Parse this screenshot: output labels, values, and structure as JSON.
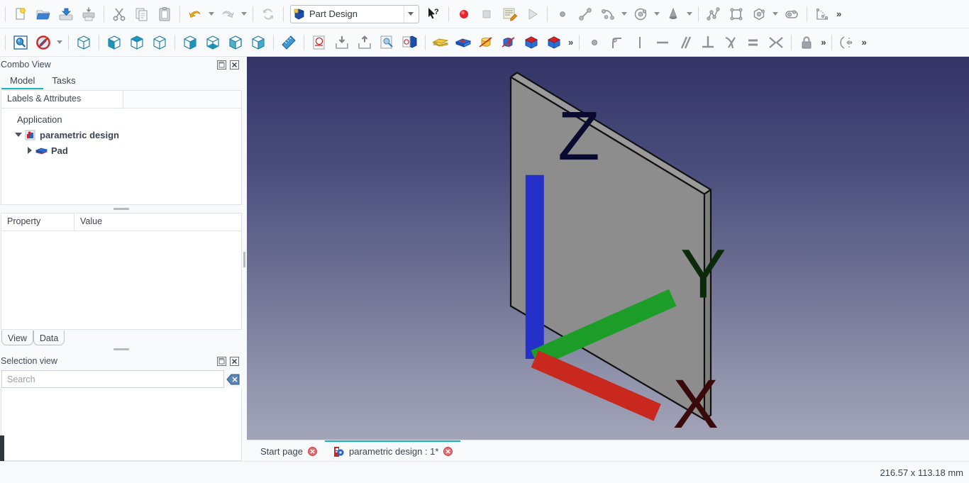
{
  "toolbars": {
    "file": [
      {
        "name": "new-document-button",
        "label": "New"
      },
      {
        "name": "open-document-button",
        "label": "Open"
      },
      {
        "name": "save-document-button",
        "label": "Save"
      },
      {
        "name": "print-document-button",
        "label": "Print"
      },
      {
        "name": "cut-button",
        "label": "Cut"
      },
      {
        "name": "copy-button",
        "label": "Copy"
      },
      {
        "name": "paste-button",
        "label": "Paste"
      },
      {
        "name": "undo-button",
        "label": "Undo"
      },
      {
        "name": "redo-button",
        "label": "Redo"
      },
      {
        "name": "refresh-button",
        "label": "Refresh"
      }
    ],
    "workbench": {
      "selected": "Part Design",
      "icon": "part-design-icon"
    },
    "whats_this": {
      "name": "whats-this-button",
      "label": "What's This?"
    },
    "macro": [
      {
        "name": "macro-record-button",
        "label": "Macro recording"
      },
      {
        "name": "macro-stop-button",
        "label": "Stop macro recording"
      },
      {
        "name": "macro-edit-button",
        "label": "Macros"
      },
      {
        "name": "macro-execute-button",
        "label": "Execute macro"
      }
    ],
    "sketcher_geometry": [
      {
        "name": "create-point-icon",
        "label": "Create point"
      },
      {
        "name": "create-line-icon",
        "label": "Create line"
      },
      {
        "name": "create-arc-icon",
        "label": "Create arc"
      },
      {
        "name": "create-circle-icon",
        "label": "Create circle"
      },
      {
        "name": "create-conic-icon",
        "label": "Create conic"
      },
      {
        "name": "create-polyline-icon",
        "label": "Create polyline"
      },
      {
        "name": "create-rectangle-icon",
        "label": "Create rectangle"
      },
      {
        "name": "create-polygon-icon",
        "label": "Create polygon"
      },
      {
        "name": "create-slot-icon",
        "label": "Create slot"
      },
      {
        "name": "create-bspline-icon",
        "label": "Create B-spline"
      }
    ],
    "view": [
      {
        "name": "fit-all-icon",
        "label": "Fit all"
      },
      {
        "name": "draw-style-icon",
        "label": "Draw style"
      },
      {
        "name": "axonometric-view-icon",
        "label": "Axonometric"
      },
      {
        "name": "front-view-icon",
        "label": "Front"
      },
      {
        "name": "top-view-icon",
        "label": "Top"
      },
      {
        "name": "right-view-icon",
        "label": "Right"
      },
      {
        "name": "rear-view-icon",
        "label": "Rear"
      },
      {
        "name": "bottom-view-icon",
        "label": "Bottom"
      },
      {
        "name": "left-view-icon",
        "label": "Left"
      },
      {
        "name": "isometric-view-icon",
        "label": "Isometric"
      },
      {
        "name": "measure-icon",
        "label": "Measure"
      }
    ],
    "partdesign": [
      {
        "name": "create-sketch-icon",
        "label": "Create sketch"
      },
      {
        "name": "import-icon",
        "label": "Import"
      },
      {
        "name": "export-icon",
        "label": "Export"
      },
      {
        "name": "validate-sketch-icon",
        "label": "Validate sketch"
      },
      {
        "name": "map-sketch-icon",
        "label": "Map sketch to face"
      },
      {
        "name": "pad-icon",
        "label": "Pad"
      },
      {
        "name": "pocket-icon",
        "label": "Pocket"
      },
      {
        "name": "revolution-icon",
        "label": "Revolution"
      },
      {
        "name": "groove-icon",
        "label": "Groove"
      },
      {
        "name": "additive-primitive-icon",
        "label": "Additive primitive"
      },
      {
        "name": "subtractive-primitive-icon",
        "label": "Subtractive primitive"
      }
    ],
    "constraints": [
      {
        "name": "constrain-coincident-icon",
        "label": "Coincident"
      },
      {
        "name": "constrain-fillet-icon",
        "label": "Fillet"
      },
      {
        "name": "constrain-vertical-icon",
        "label": "Vertical"
      },
      {
        "name": "constrain-horizontal-icon",
        "label": "Horizontal"
      },
      {
        "name": "constrain-parallel-icon",
        "label": "Parallel"
      },
      {
        "name": "constrain-perpendicular-icon",
        "label": "Perpendicular"
      },
      {
        "name": "constrain-tangent-icon",
        "label": "Tangent"
      },
      {
        "name": "constrain-equal-icon",
        "label": "Equal"
      },
      {
        "name": "constrain-symmetric-icon",
        "label": "Symmetric"
      },
      {
        "name": "constrain-block-icon",
        "label": "Block"
      },
      {
        "name": "constrain-dimension-icon",
        "label": "Dimension"
      }
    ],
    "overflow_label": "»"
  },
  "combo_view": {
    "title": "Combo View",
    "tabs": [
      {
        "label": "Model",
        "active": true
      },
      {
        "label": "Tasks",
        "active": false
      }
    ],
    "tree_column_header": "Labels & Attributes",
    "tree": {
      "root_label": "Application",
      "document": {
        "label": "parametric design",
        "expanded": true,
        "children": [
          {
            "label": "Pad",
            "expanded": false
          }
        ]
      }
    },
    "property_table": {
      "columns": [
        "Property",
        "Value"
      ],
      "rows": []
    },
    "bottom_tabs": [
      {
        "label": "View",
        "active": false
      },
      {
        "label": "Data",
        "active": false
      }
    ]
  },
  "selection_view": {
    "title": "Selection view",
    "search_placeholder": "Search",
    "search_value": "",
    "items": []
  },
  "viewport": {
    "axis_labels": {
      "x": "X",
      "y": "Y",
      "z": "Z"
    },
    "axis_colors": {
      "x": "#c8281e",
      "y": "#1c9d28",
      "z": "#2430c8"
    },
    "background_top": "#333366",
    "background_bottom": "#a2a4b8",
    "solid_face_color": "#8c8c8c",
    "solid_edge_color": "#101010"
  },
  "document_tabs": [
    {
      "label": "Start page",
      "active": false,
      "closable": true,
      "has_icon": false
    },
    {
      "label": "parametric design : 1*",
      "active": true,
      "closable": true,
      "has_icon": true
    }
  ],
  "status_bar": {
    "dimensions": "216.57 x 113.18 mm"
  }
}
